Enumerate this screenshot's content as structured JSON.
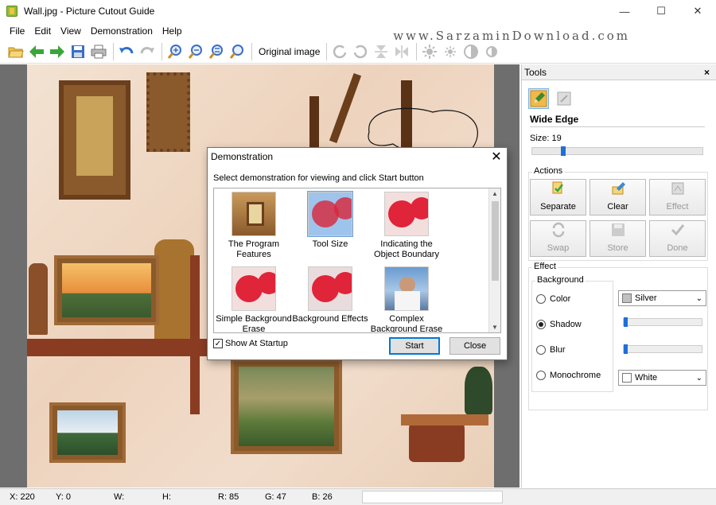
{
  "window": {
    "title": "Wall.jpg - Picture Cutout Guide",
    "minimize": "—",
    "maximize": "☐",
    "close": "✕"
  },
  "menu": [
    "File",
    "Edit",
    "View",
    "Demonstration",
    "Help"
  ],
  "watermark": "www.SarzaminDownload.com",
  "toolbar": {
    "original_image_label": "Original image"
  },
  "panel": {
    "title": "Tools",
    "close": "×",
    "tool_title": "Wide Edge",
    "size_label": "Size: 19",
    "size_value": 19,
    "actions_label": "Actions",
    "actions": [
      {
        "label": "Separate",
        "icon": "separate-icon",
        "enabled": true
      },
      {
        "label": "Clear",
        "icon": "clear-icon",
        "enabled": true
      },
      {
        "label": "Effect",
        "icon": "effect-icon",
        "enabled": false
      },
      {
        "label": "Swap",
        "icon": "swap-icon",
        "enabled": false
      },
      {
        "label": "Store",
        "icon": "store-icon",
        "enabled": false
      },
      {
        "label": "Done",
        "icon": "done-icon",
        "enabled": false
      }
    ],
    "effect_label": "Effect",
    "background_label": "Background",
    "options": [
      {
        "label": "Color",
        "selected": false
      },
      {
        "label": "Shadow",
        "selected": true
      },
      {
        "label": "Blur",
        "selected": false
      },
      {
        "label": "Monochrome",
        "selected": false
      }
    ],
    "color_select": "Silver",
    "color_swatch": "#c0c0c0",
    "mono_select": "White",
    "mono_swatch": "#ffffff"
  },
  "dialog": {
    "title": "Demonstration",
    "close": "✕",
    "instruction": "Select demonstration for viewing and click Start button",
    "items": [
      {
        "label": "The Program Features"
      },
      {
        "label": "Tool Size"
      },
      {
        "label": "Indicating the Object Boundary"
      },
      {
        "label": "Simple Background Erase"
      },
      {
        "label": "Background Effects"
      },
      {
        "label": "Complex Background Erase"
      }
    ],
    "show_at_startup": "Show At Startup",
    "show_at_startup_checked": true,
    "start": "Start",
    "close_btn": "Close"
  },
  "status": {
    "x": "X: 220",
    "y": "Y: 0",
    "w": "W:",
    "h": "H:",
    "r": "R: 85",
    "g": "G: 47",
    "b": "B: 26"
  },
  "colors": {
    "accent": "#0078d7",
    "slider": "#1e6fd6",
    "selection": "#9fc4ec"
  }
}
